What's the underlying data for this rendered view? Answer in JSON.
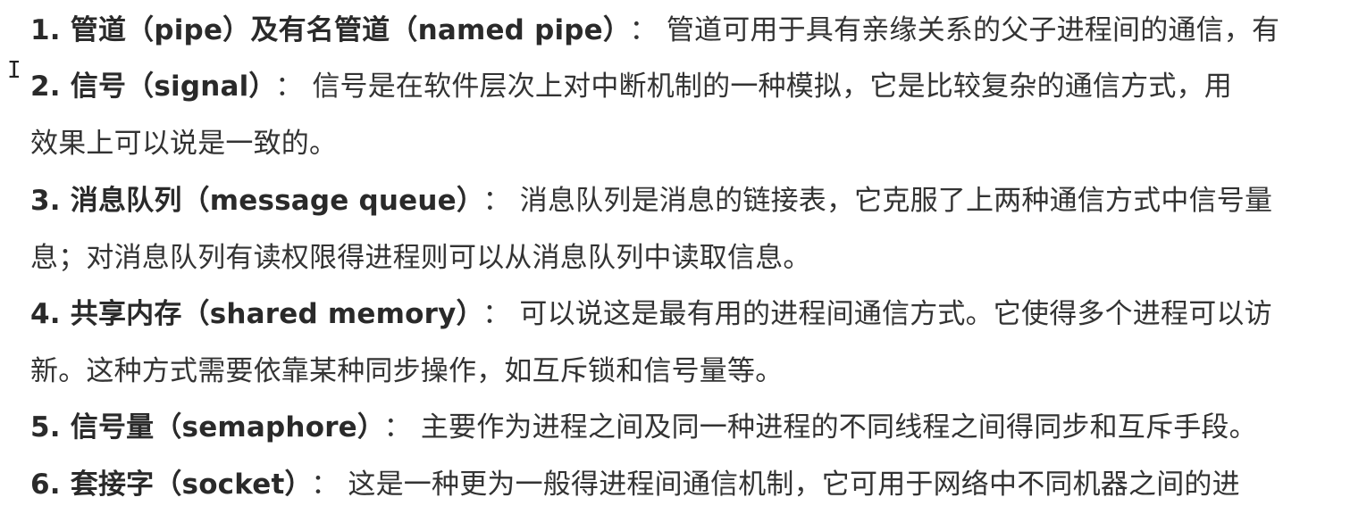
{
  "items": [
    {
      "term": "1. 管道（pipe）及有名管道（named pipe）",
      "sep": "：",
      "desc": "管道可用于具有亲缘关系的父子进程间的通信，有"
    },
    {
      "term": "2. 信号（signal）",
      "sep": "：",
      "desc": "信号是在软件层次上对中断机制的一种模拟，它是比较复杂的通信方式，用",
      "cont": "效果上可以说是一致的。"
    },
    {
      "term": "3. 消息队列（message queue）",
      "sep": "：",
      "desc": "消息队列是消息的链接表，它克服了上两种通信方式中信号量",
      "cont": "息；对消息队列有读权限得进程则可以从消息队列中读取信息。"
    },
    {
      "term": "4. 共享内存（shared memory）",
      "sep": "：",
      "desc": "可以说这是最有用的进程间通信方式。它使得多个进程可以访",
      "cont": "新。这种方式需要依靠某种同步操作，如互斥锁和信号量等。"
    },
    {
      "term": "5. 信号量（semaphore）",
      "sep": "：",
      "desc": "主要作为进程之间及同一种进程的不同线程之间得同步和互斥手段。"
    },
    {
      "term": "6. 套接字（socket）",
      "sep": "：",
      "desc": "这是一种更为一般得进程间通信机制，它可用于网络中不同机器之间的进"
    }
  ],
  "text_cursor_glyph": "I"
}
